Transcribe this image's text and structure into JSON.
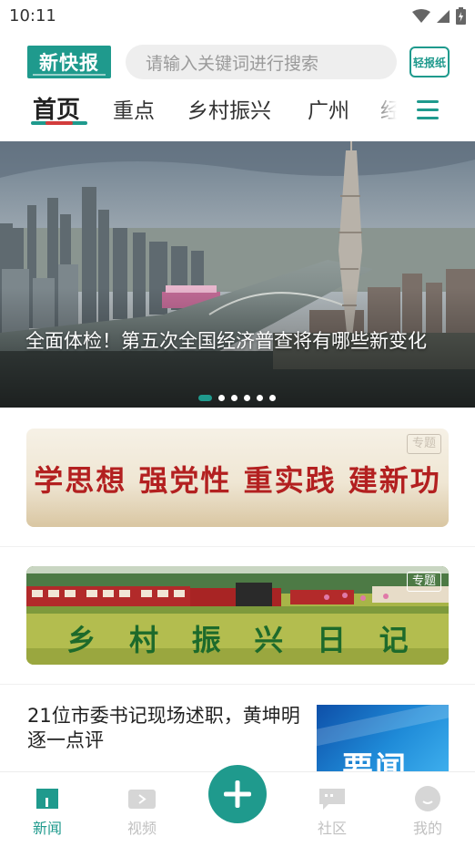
{
  "status_bar": {
    "time": "10:11",
    "icons": [
      "wifi-icon",
      "signal-icon",
      "battery-charging-icon"
    ]
  },
  "header": {
    "logo_text": "新快报",
    "search_placeholder": "请输入关键词进行搜索",
    "paper_button_label": "轻报纸"
  },
  "tabs": {
    "items": [
      {
        "label": "首页",
        "active": true
      },
      {
        "label": "重点",
        "active": false
      },
      {
        "label": "乡村振兴",
        "active": false
      },
      {
        "label": "广州",
        "active": false
      },
      {
        "label": "经",
        "active": false
      }
    ],
    "menu_icon": "hamburger-menu-icon"
  },
  "hero": {
    "title": "全面体检！第五次全国经济普查将有哪些新变化",
    "slide_count": 6,
    "active_slide": 1
  },
  "feature_banners": [
    {
      "text": "学思想  强党性  重实践  建新功",
      "badge": "专题"
    },
    {
      "chars": [
        "乡",
        "村",
        "振",
        "兴",
        "日",
        "记"
      ],
      "badge": "专题"
    }
  ],
  "news": [
    {
      "title": "21位市委书记现场述职，黄坤明逐一点评",
      "thumb_label": "要闻"
    }
  ],
  "bottom_nav": {
    "items": [
      {
        "label": "新闻",
        "icon": "news-icon",
        "active": true
      },
      {
        "label": "视频",
        "icon": "video-icon",
        "active": false
      },
      {
        "label": "社区",
        "icon": "community-icon",
        "active": false
      },
      {
        "label": "我的",
        "icon": "profile-icon",
        "active": false
      }
    ],
    "post_icon": "plus-icon"
  },
  "colors": {
    "accent": "#1f9a8d",
    "tab_underline_red": "#d23c3c",
    "banner1_text": "#b32020",
    "banner2_text": "#1d6a2b",
    "inactive_nav": "#c0c0c0"
  }
}
